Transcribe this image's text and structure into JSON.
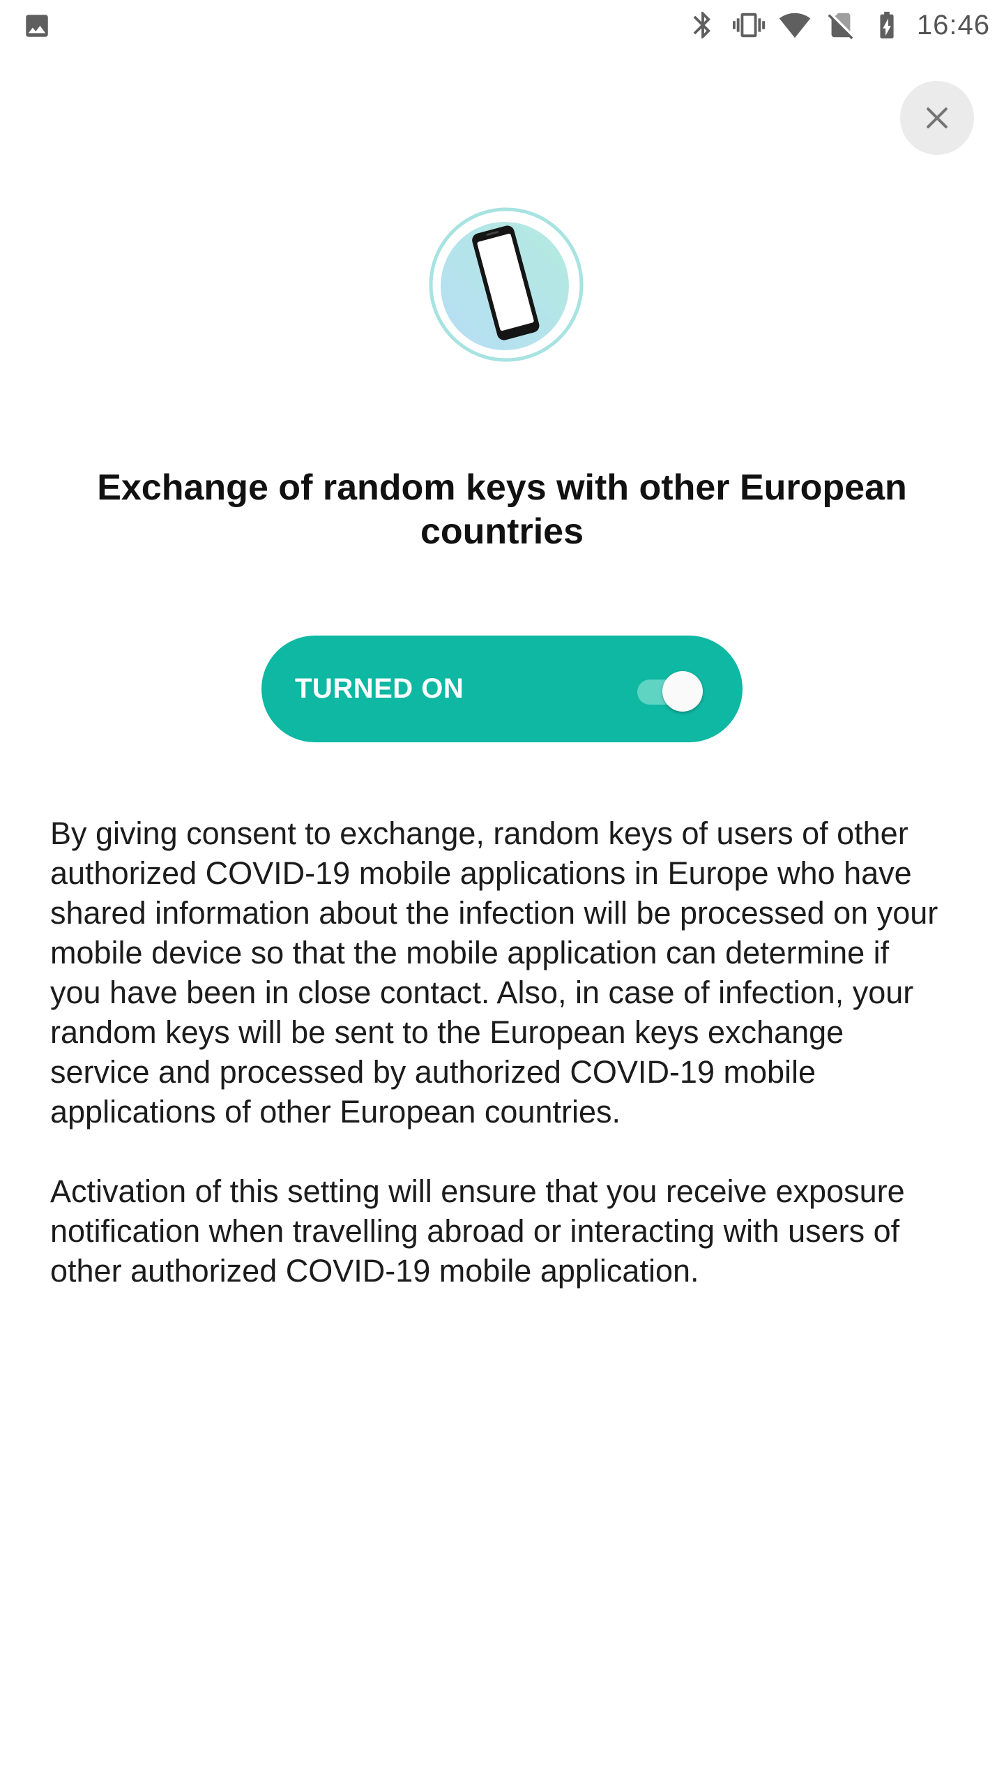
{
  "status_bar": {
    "time": "16:46",
    "icons": [
      "image-icon",
      "bluetooth-icon",
      "vibrate-icon",
      "wifi-icon",
      "no-sim-icon",
      "battery-charging-icon"
    ]
  },
  "close_button": {
    "icon": "close-icon"
  },
  "illustration": {
    "icon": "phone-icon"
  },
  "title": "Exchange of random keys with other European countries",
  "toggle": {
    "label": "TURNED ON",
    "on": true,
    "color": "#0eb8a3"
  },
  "body": {
    "paragraph_1": "By giving consent to exchange, random keys of users of other authorized COVID-19 mobile applications in Europe who have shared information about the infection will be processed on your mobile device so that the mobile application can determine if you have been in close contact. Also, in case of infection, your random keys will be sent to the European keys exchange service and processed by authorized COVID-19 mobile applications of other European countries.",
    "paragraph_2": "Activation of this setting will ensure that you receive exposure notification when travelling abroad or interacting with users of other authorized COVID-19 mobile application."
  }
}
